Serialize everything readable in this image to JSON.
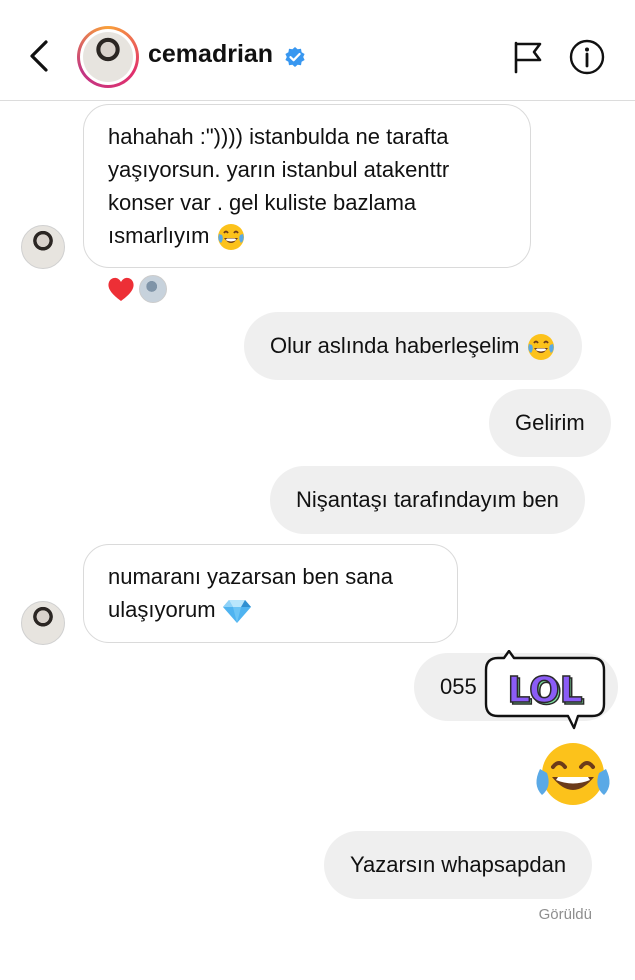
{
  "header": {
    "username": "cemadrian",
    "verified": true,
    "icons": [
      "back-chevron-icon",
      "verified-badge-icon",
      "report-flag-icon",
      "info-icon"
    ]
  },
  "messages": [
    {
      "sender": "cemadrian",
      "lines": [
        "hahahah :\")))) istanbulda ne tarafta",
        "yaşıyorsun. yarın istanbul atakenttr",
        "konser var . gel kuliste bazlama",
        "ısmarlıyım"
      ],
      "trailing_emoji": "face-with-tears-of-joy",
      "reactions": [
        "red-heart",
        "avatar"
      ]
    },
    {
      "sender": "me",
      "text": "Olur aslında haberleşelim",
      "trailing_emoji": "face-with-tears-of-joy"
    },
    {
      "sender": "me",
      "text": "Gelirim"
    },
    {
      "sender": "me",
      "text": "Nişantaşı tarafındayım ben"
    },
    {
      "sender": "cemadrian",
      "lines": [
        "numaranı yazarsan ben sana",
        "ulaşıyorum"
      ],
      "trailing_emoji": "gem-stone"
    },
    {
      "sender": "me",
      "text": "055",
      "sticker": {
        "text": "LOL"
      }
    },
    {
      "sender": "me",
      "emoji_only": "face-with-tears-of-joy"
    },
    {
      "sender": "me",
      "text": "Yazarsın whapsapdan"
    }
  ],
  "status": {
    "seen": "Görüldü"
  },
  "colors": {
    "outgoing_bubble": "#efefef",
    "incoming_border": "#dadada",
    "verified": "#3897f0",
    "sticker_purple": "#8b5cf6",
    "sticker_green": "#7ee3a0",
    "seen_text": "#8e8e8e"
  }
}
